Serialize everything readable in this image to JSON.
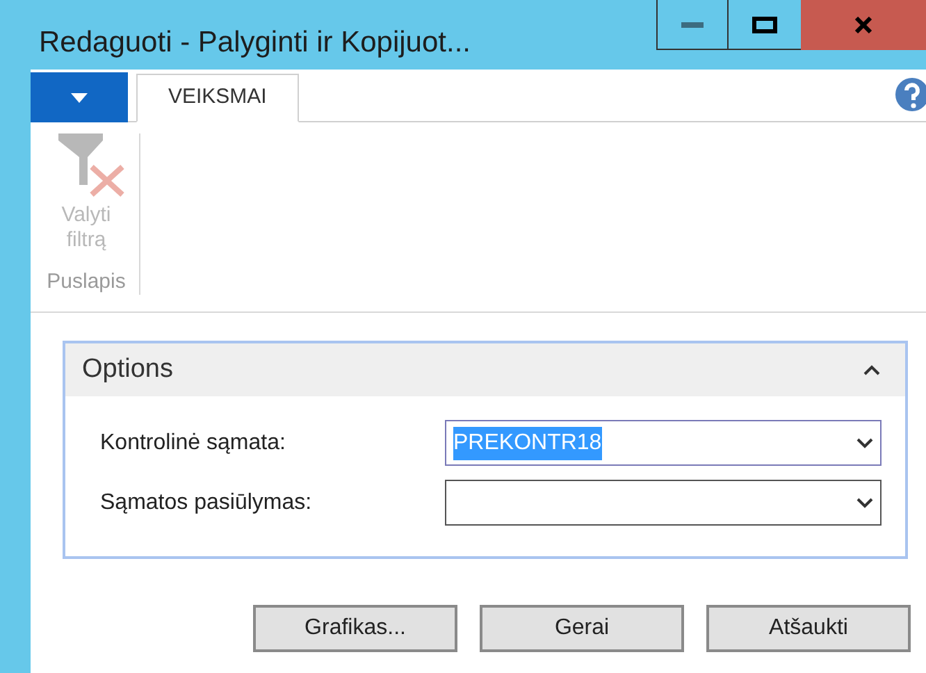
{
  "window": {
    "title": "Redaguoti - Palyginti ir Kopijuot..."
  },
  "tabs": [
    {
      "label": "VEIKSMAI",
      "selected": true
    }
  ],
  "ribbon": {
    "actions": [
      {
        "label": "Valyti filtrą",
        "disabled": true
      }
    ],
    "group": "Puslapis"
  },
  "options": {
    "title": "Options",
    "expanded": true,
    "fields": [
      {
        "label": "Kontrolinė sąmata:",
        "value": "PREKONTR18",
        "text_selected": true
      },
      {
        "label": "Sąmatos pasiūlymas:",
        "text_selected": false
      }
    ]
  },
  "buttons": [
    "Grafikas...",
    "Gerai",
    "Atšaukti"
  ]
}
